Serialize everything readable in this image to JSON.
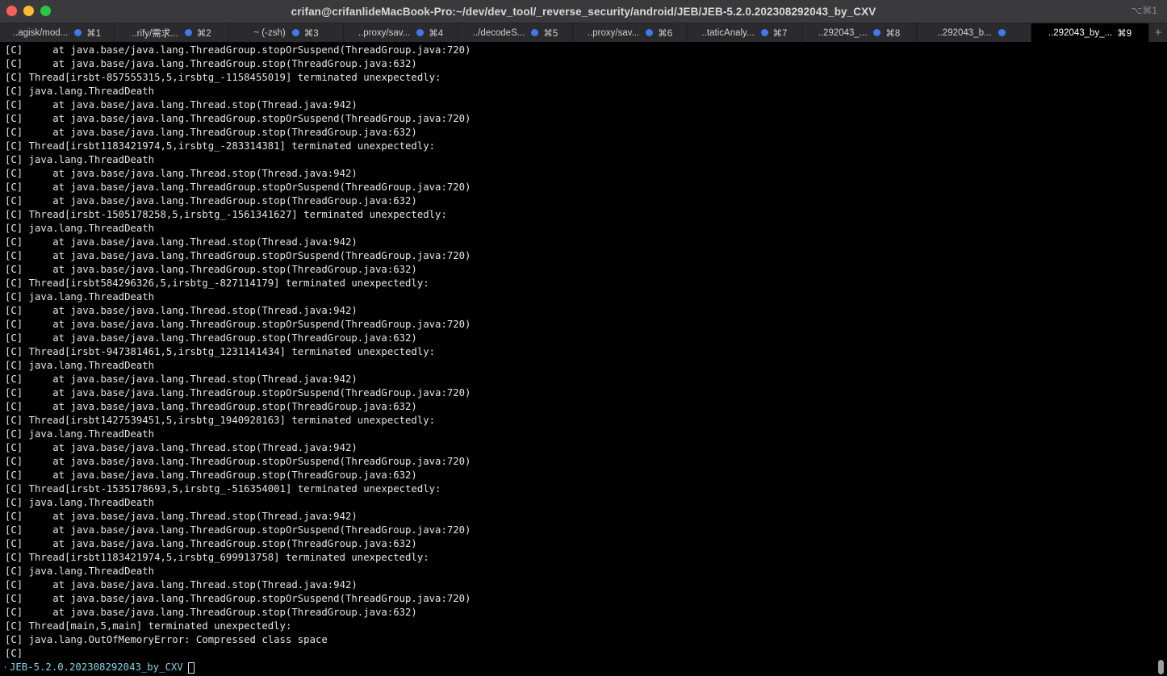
{
  "window": {
    "title": "crifan@crifanlideMacBook-Pro:~/dev/dev_tool/_reverse_security/android/JEB/JEB-5.2.0.202308292043_by_CXV",
    "shortcut": "⌥⌘1"
  },
  "tabs": [
    {
      "label": "..agisk/mod...",
      "key": "⌘1"
    },
    {
      "label": "..rify/需求...",
      "key": "⌘2"
    },
    {
      "label": "~ (-zsh)",
      "key": "⌘3"
    },
    {
      "label": "..proxy/sav...",
      "key": "⌘4"
    },
    {
      "label": "../decodeS...",
      "key": "⌘5"
    },
    {
      "label": "..proxy/sav...",
      "key": "⌘6"
    },
    {
      "label": "..taticAnaly...",
      "key": "⌘7"
    },
    {
      "label": "..292043_...",
      "key": "⌘8"
    },
    {
      "label": "..292043_b...",
      "key": ""
    },
    {
      "label": "..292043_by_...",
      "key": "⌘9"
    }
  ],
  "newtab_symbol": "+",
  "terminal": {
    "lines": [
      "[C]     at java.base/java.lang.ThreadGroup.stopOrSuspend(ThreadGroup.java:720)",
      "[C]     at java.base/java.lang.ThreadGroup.stop(ThreadGroup.java:632)",
      "[C] Thread[irsbt-857555315,5,irsbtg_-1158455019] terminated unexpectedly:",
      "[C] java.lang.ThreadDeath",
      "[C]     at java.base/java.lang.Thread.stop(Thread.java:942)",
      "[C]     at java.base/java.lang.ThreadGroup.stopOrSuspend(ThreadGroup.java:720)",
      "[C]     at java.base/java.lang.ThreadGroup.stop(ThreadGroup.java:632)",
      "[C] Thread[irsbt1183421974,5,irsbtg_-283314381] terminated unexpectedly:",
      "[C] java.lang.ThreadDeath",
      "[C]     at java.base/java.lang.Thread.stop(Thread.java:942)",
      "[C]     at java.base/java.lang.ThreadGroup.stopOrSuspend(ThreadGroup.java:720)",
      "[C]     at java.base/java.lang.ThreadGroup.stop(ThreadGroup.java:632)",
      "[C] Thread[irsbt-1505178258,5,irsbtg_-1561341627] terminated unexpectedly:",
      "[C] java.lang.ThreadDeath",
      "[C]     at java.base/java.lang.Thread.stop(Thread.java:942)",
      "[C]     at java.base/java.lang.ThreadGroup.stopOrSuspend(ThreadGroup.java:720)",
      "[C]     at java.base/java.lang.ThreadGroup.stop(ThreadGroup.java:632)",
      "[C] Thread[irsbt584296326,5,irsbtg_-827114179] terminated unexpectedly:",
      "[C] java.lang.ThreadDeath",
      "[C]     at java.base/java.lang.Thread.stop(Thread.java:942)",
      "[C]     at java.base/java.lang.ThreadGroup.stopOrSuspend(ThreadGroup.java:720)",
      "[C]     at java.base/java.lang.ThreadGroup.stop(ThreadGroup.java:632)",
      "[C] Thread[irsbt-947381461,5,irsbtg_1231141434] terminated unexpectedly:",
      "[C] java.lang.ThreadDeath",
      "[C]     at java.base/java.lang.Thread.stop(Thread.java:942)",
      "[C]     at java.base/java.lang.ThreadGroup.stopOrSuspend(ThreadGroup.java:720)",
      "[C]     at java.base/java.lang.ThreadGroup.stop(ThreadGroup.java:632)",
      "[C] Thread[irsbt1427539451,5,irsbtg_1940928163] terminated unexpectedly:",
      "[C] java.lang.ThreadDeath",
      "[C]     at java.base/java.lang.Thread.stop(Thread.java:942)",
      "[C]     at java.base/java.lang.ThreadGroup.stopOrSuspend(ThreadGroup.java:720)",
      "[C]     at java.base/java.lang.ThreadGroup.stop(ThreadGroup.java:632)",
      "[C] Thread[irsbt-1535178693,5,irsbtg_-516354001] terminated unexpectedly:",
      "[C] java.lang.ThreadDeath",
      "[C]     at java.base/java.lang.Thread.stop(Thread.java:942)",
      "[C]     at java.base/java.lang.ThreadGroup.stopOrSuspend(ThreadGroup.java:720)",
      "[C]     at java.base/java.lang.ThreadGroup.stop(ThreadGroup.java:632)",
      "[C] Thread[irsbt1183421974,5,irsbtg_699913758] terminated unexpectedly:",
      "[C] java.lang.ThreadDeath",
      "[C]     at java.base/java.lang.Thread.stop(Thread.java:942)",
      "[C]     at java.base/java.lang.ThreadGroup.stopOrSuspend(ThreadGroup.java:720)",
      "[C]     at java.base/java.lang.ThreadGroup.stop(ThreadGroup.java:632)",
      "[C] Thread[main,5,main] terminated unexpectedly:",
      "[C] java.lang.OutOfMemoryError: Compressed class space",
      "[C]"
    ],
    "prompt_arrow": "➜",
    "prompt": "JEB-5.2.0.202308292043_by_CXV"
  },
  "colors": {
    "background": "#000000",
    "text": "#e6e6e6",
    "prompt": "#7fd8e8",
    "tab_dot": "#3b7bf0"
  }
}
